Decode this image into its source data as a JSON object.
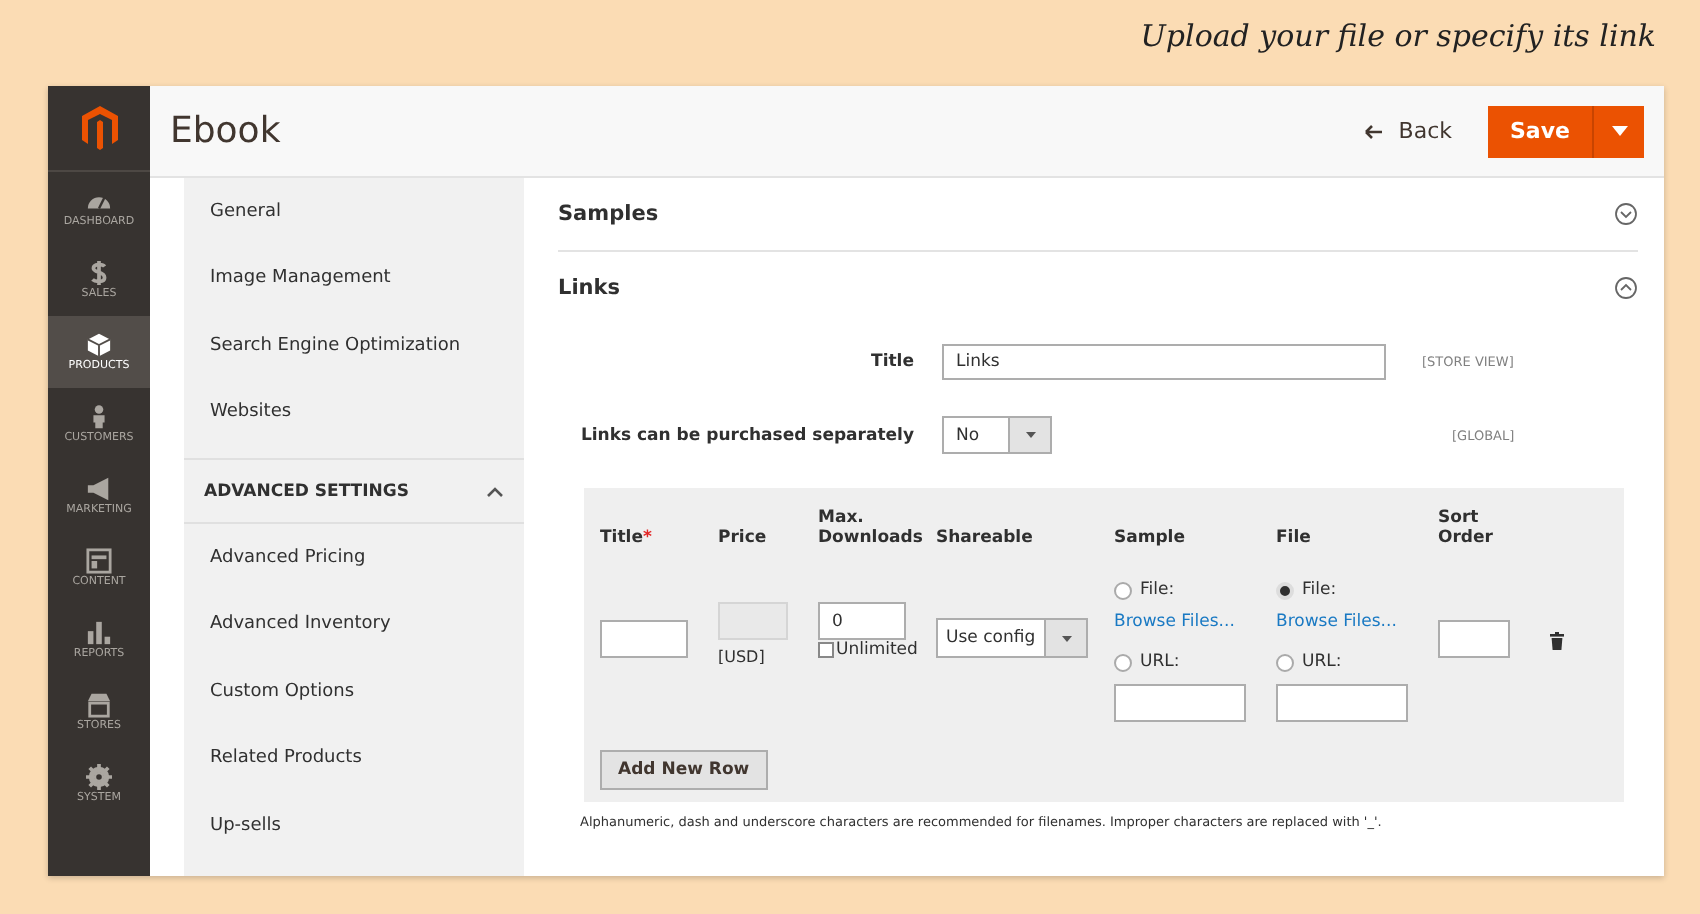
{
  "caption": "Upload your file or specify its link",
  "nav": {
    "items": [
      {
        "label": "DASHBOARD",
        "selected": false
      },
      {
        "label": "SALES",
        "selected": false
      },
      {
        "label": "PRODUCTS",
        "selected": true
      },
      {
        "label": "CUSTOMERS",
        "selected": false
      },
      {
        "label": "MARKETING",
        "selected": false
      },
      {
        "label": "CONTENT",
        "selected": false
      },
      {
        "label": "REPORTS",
        "selected": false
      },
      {
        "label": "STORES",
        "selected": false
      },
      {
        "label": "SYSTEM",
        "selected": false
      }
    ]
  },
  "header": {
    "title": "Ebook",
    "back": "Back",
    "save": "Save"
  },
  "sidebar": {
    "items": [
      "General",
      "Image Management",
      "Search Engine Optimization",
      "Websites"
    ],
    "advanced": {
      "title": "ADVANCED SETTINGS",
      "expanded": true,
      "items": [
        "Advanced Pricing",
        "Advanced Inventory",
        "Custom Options",
        "Related Products",
        "Up-sells"
      ]
    }
  },
  "sections": [
    {
      "title": "Samples",
      "expanded": false
    },
    {
      "title": "Links",
      "expanded": true
    }
  ],
  "links_form": {
    "fields": [
      {
        "label": "Title",
        "kind": "text",
        "value": "Links",
        "scope": "[STORE VIEW]"
      },
      {
        "label": "Links can be purchased separately",
        "kind": "select",
        "value": "No",
        "scope": "[GLOBAL]"
      }
    ],
    "table": {
      "columns": [
        {
          "label": "Title",
          "required_mark": "*"
        },
        {
          "label": "Price"
        },
        {
          "label": "Max. Downloads"
        },
        {
          "label": "Shareable"
        },
        {
          "label": "Sample"
        },
        {
          "label": "File"
        },
        {
          "label": "Sort Order"
        }
      ],
      "rows": [
        {
          "title": "",
          "price": "",
          "price_disabled": true,
          "currency": "[USD]",
          "max_downloads": "0",
          "unlimited": {
            "label": "Unlimited",
            "checked": false
          },
          "shareable": "Use config",
          "sample": {
            "file": {
              "label": "File:",
              "selected": false
            },
            "browse": "Browse Files...",
            "url": {
              "label": "URL:",
              "selected": false
            }
          },
          "file": {
            "file": {
              "label": "File:",
              "selected": true
            },
            "browse": "Browse Files...",
            "url": {
              "label": "URL:",
              "selected": false
            }
          },
          "sort_order": ""
        }
      ]
    },
    "add_button": "Add New Row",
    "note": "Alphanumeric, dash and underscore characters are recommended for filenames. Improper characters are replaced with '_'."
  }
}
